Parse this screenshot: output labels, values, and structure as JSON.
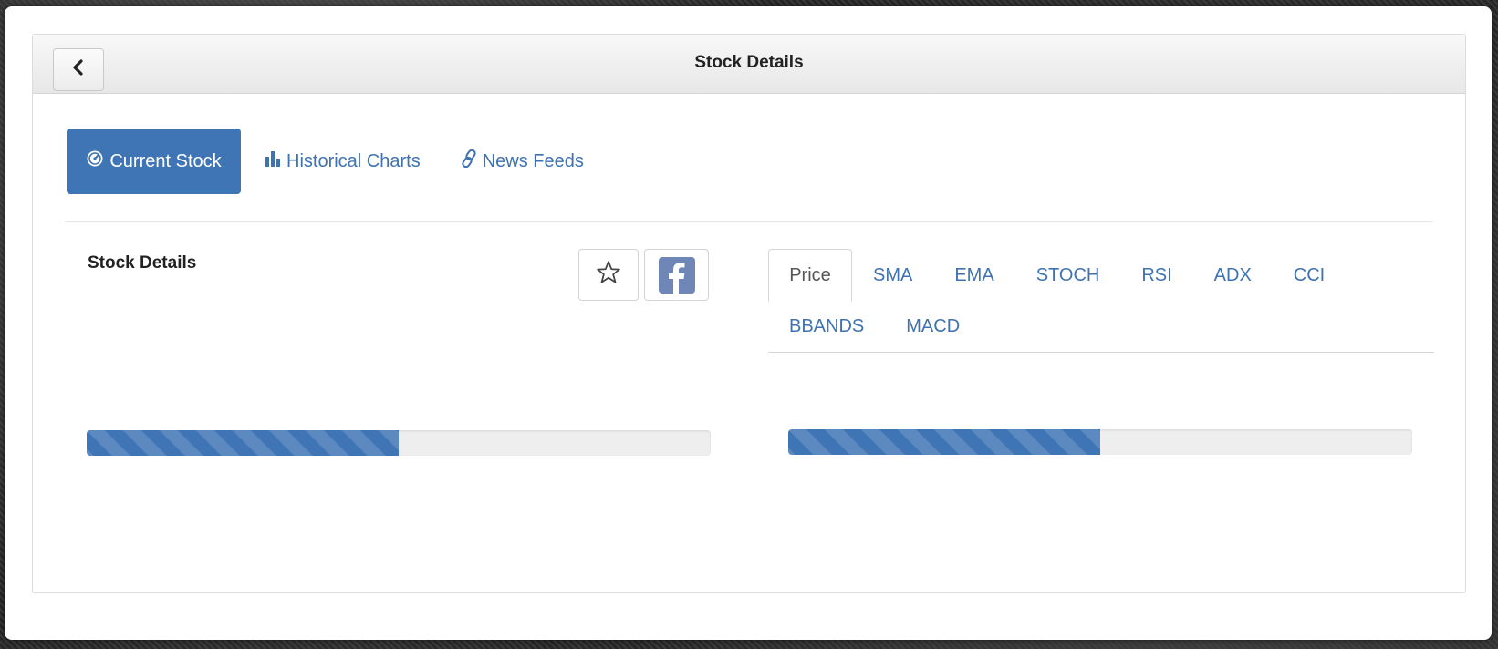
{
  "header": {
    "title": "Stock Details",
    "back_icon": "chevron-left-icon"
  },
  "nav": {
    "items": [
      {
        "label": "Current Stock",
        "icon": "dashboard-icon",
        "active": true
      },
      {
        "label": "Historical Charts",
        "icon": "bar-chart-icon",
        "active": false
      },
      {
        "label": "News Feeds",
        "icon": "link-icon",
        "active": false
      }
    ]
  },
  "details": {
    "title": "Stock Details",
    "favorite_icon": "star-outline-icon",
    "share_icon": "facebook-icon",
    "progress": 0.5
  },
  "chart_tabs": {
    "items": [
      "Price",
      "SMA",
      "EMA",
      "STOCH",
      "RSI",
      "ADX",
      "CCI",
      "BBANDS",
      "MACD"
    ],
    "active": "Price",
    "progress": 0.5
  },
  "colors": {
    "accent": "#3f75b5",
    "link": "#3f72b0",
    "facebook": "#6f87b7"
  }
}
